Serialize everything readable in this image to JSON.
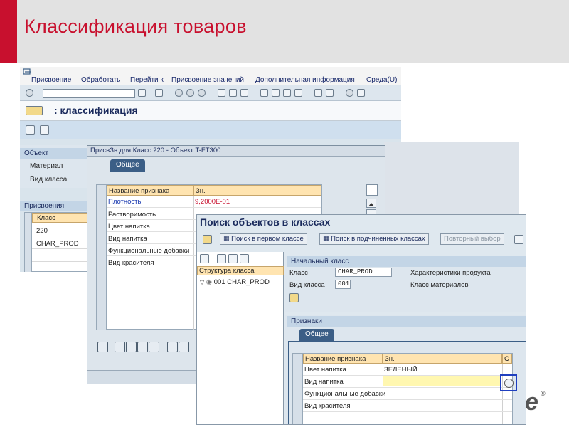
{
  "slide": {
    "title": "Классификация товаров"
  },
  "win1": {
    "menu": [
      "Присвоение",
      "Обработать",
      "Перейти к",
      "Присвоение значений",
      "Дополнительная информация",
      "Среда(U)"
    ],
    "screen_title": ": классификация",
    "object_section": "Объект",
    "fields": {
      "material": "Материал",
      "class_type": "Вид класса"
    },
    "assign_section": "Присвоения",
    "class_col": "Класс",
    "class_rows": [
      "220",
      "CHAR_PROD"
    ]
  },
  "win2": {
    "title": "ПрисвЗн для Класс 220 - Объект T-FT300",
    "tab": "Общее",
    "col_name": "Название признака",
    "col_value": "Зн.",
    "rows": [
      {
        "name": "Плотность",
        "value": "9,2000E-01"
      },
      {
        "name": "Растворимость",
        "value": ""
      },
      {
        "name": "Цвет напитка",
        "value": ""
      },
      {
        "name": "Вид напитка",
        "value": ""
      },
      {
        "name": "Функциональные добавки",
        "value": ""
      },
      {
        "name": "Вид красителя",
        "value": ""
      }
    ]
  },
  "win3": {
    "title": "Поиск объектов в классах",
    "buttons": {
      "search_first": "Поиск в первом классе",
      "search_sub": "Поиск в подчиненных классах",
      "repeat": "Повторный выбор"
    },
    "tree_header": "Структура класса",
    "tree_node": "001 CHAR_PROD",
    "start_section": "Начальный класс",
    "class_label": "Класс",
    "class_value": "CHAR_PROD",
    "class_desc": "Характеристики продукта",
    "class_type_label": "Вид класса",
    "class_type_value": "001",
    "class_type_desc": "Класс материалов",
    "features_section": "Признаки",
    "tab": "Общее",
    "col_name": "Название признака",
    "col_value": "Зн.",
    "col_c": "С",
    "rows": [
      {
        "name": "Цвет напитка",
        "value": "ЗЕЛЕНЫЙ"
      },
      {
        "name": "Вид напитка",
        "value": ""
      },
      {
        "name": "Функциональные добавки",
        "value": ""
      },
      {
        "name": "Вид красителя",
        "value": ""
      }
    ]
  },
  "brand": {
    "logo_fragment": "e",
    "reg": "®"
  },
  "colors": {
    "accent": "#c8102e",
    "sap_blue": "#3b5e86",
    "header_bg": "#e2e2e2",
    "grid_header": "#ffe4b0"
  }
}
